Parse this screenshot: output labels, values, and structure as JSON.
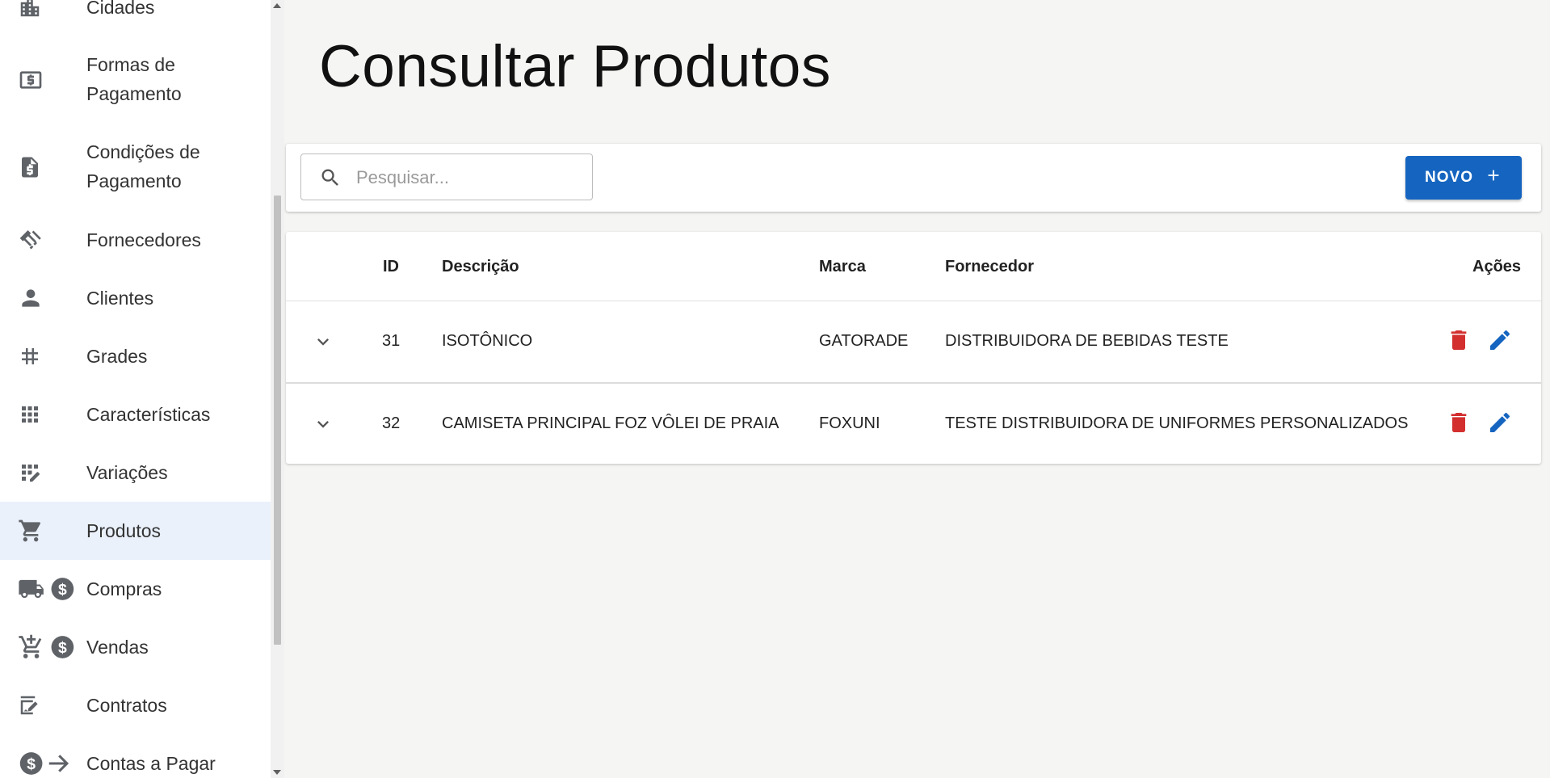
{
  "sidebar": {
    "items": [
      {
        "label": "Cidades",
        "icon": "city-icon"
      },
      {
        "label": "Formas de Pagamento",
        "icon": "payment-icon"
      },
      {
        "label": "Condições de Pagamento",
        "icon": "invoice-icon"
      },
      {
        "label": "Fornecedores",
        "icon": "handshake-icon"
      },
      {
        "label": "Clientes",
        "icon": "person-icon"
      },
      {
        "label": "Grades",
        "icon": "hashtag-icon"
      },
      {
        "label": "Características",
        "icon": "grid-icon"
      },
      {
        "label": "Variações",
        "icon": "grid-edit-icon"
      },
      {
        "label": "Produtos",
        "icon": "cart-icon",
        "active": true
      },
      {
        "label": "Compras",
        "icon": "truck-dollar-icon"
      },
      {
        "label": "Vendas",
        "icon": "cart-add-dollar-icon"
      },
      {
        "label": "Contratos",
        "icon": "contract-icon"
      },
      {
        "label": "Contas a Pagar",
        "icon": "dollar-arrow-icon"
      }
    ]
  },
  "page": {
    "title": "Consultar Produtos"
  },
  "toolbar": {
    "search_placeholder": "Pesquisar...",
    "search_value": "",
    "new_button_label": "NOVO"
  },
  "table": {
    "headers": {
      "id": "ID",
      "descricao": "Descrição",
      "marca": "Marca",
      "fornecedor": "Fornecedor",
      "acoes": "Ações"
    },
    "rows": [
      {
        "id": "31",
        "descricao": "ISOTÔNICO",
        "marca": "GATORADE",
        "fornecedor": "DISTRIBUIDORA DE BEBIDAS TESTE"
      },
      {
        "id": "32",
        "descricao": "CAMISETA PRINCIPAL FOZ VÔLEI DE PRAIA",
        "marca": "FOXUNI",
        "fornecedor": "TESTE DISTRIBUIDORA DE UNIFORMES PERSONALIZADOS"
      }
    ]
  },
  "colors": {
    "primary": "#1565c0",
    "danger": "#d32f2f",
    "active_nav": "#eaf1fb",
    "icon_gray": "#5f6368"
  }
}
